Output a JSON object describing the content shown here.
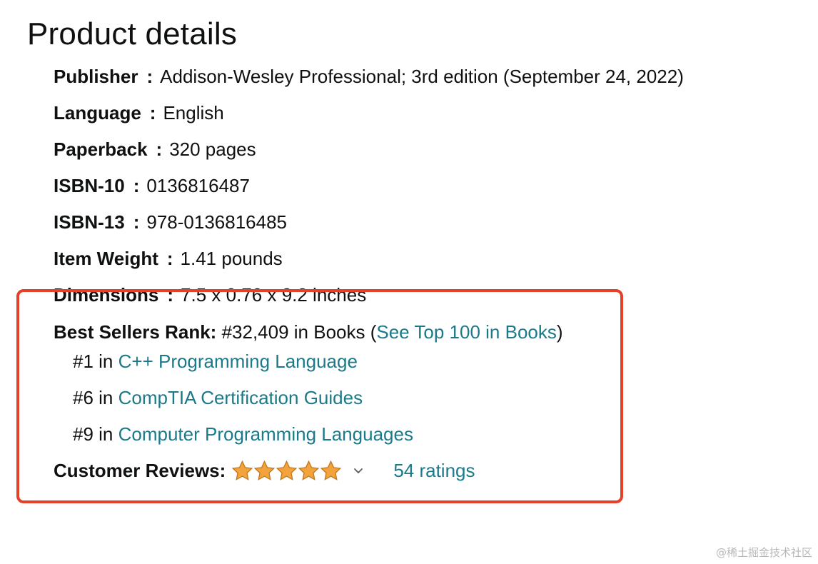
{
  "title": "Product details",
  "details": [
    {
      "label": "Publisher",
      "sep": ":",
      "value": "Addison-Wesley Professional; 3rd edition (September 24, 2022)"
    },
    {
      "label": "Language",
      "sep": ":",
      "value": "English"
    },
    {
      "label": "Paperback",
      "sep": ":",
      "value": "320 pages"
    },
    {
      "label": "ISBN-10",
      "sep": ":",
      "value": "0136816487"
    },
    {
      "label": "ISBN-13",
      "sep": ":",
      "value": "978-0136816485"
    },
    {
      "label": "Item Weight",
      "sep": ":",
      "value": "1.41 pounds"
    },
    {
      "label": "Dimensions",
      "sep": ":",
      "value": "7.5 x 0.76 x 9.2 inches"
    }
  ],
  "best_sellers": {
    "label": "Best Sellers Rank:",
    "rank_text": "#32,409 in Books (",
    "top100_link": "See Top 100 in Books",
    "close_paren": ")",
    "sub_ranks": [
      {
        "rank": "#1 in ",
        "category": "C++ Programming Language"
      },
      {
        "rank": "#6 in ",
        "category": "CompTIA Certification Guides"
      },
      {
        "rank": "#9 in ",
        "category": "Computer Programming Languages"
      }
    ]
  },
  "reviews": {
    "label": "Customer Reviews:",
    "rating_stars": 5,
    "chevron_icon": "chevron-down-icon",
    "ratings_link": "54 ratings"
  },
  "watermark": "@稀土掘金技术社区",
  "colors": {
    "link": "#1a7a8a",
    "star": "#f3a33b",
    "highlight": "#e5402a"
  }
}
